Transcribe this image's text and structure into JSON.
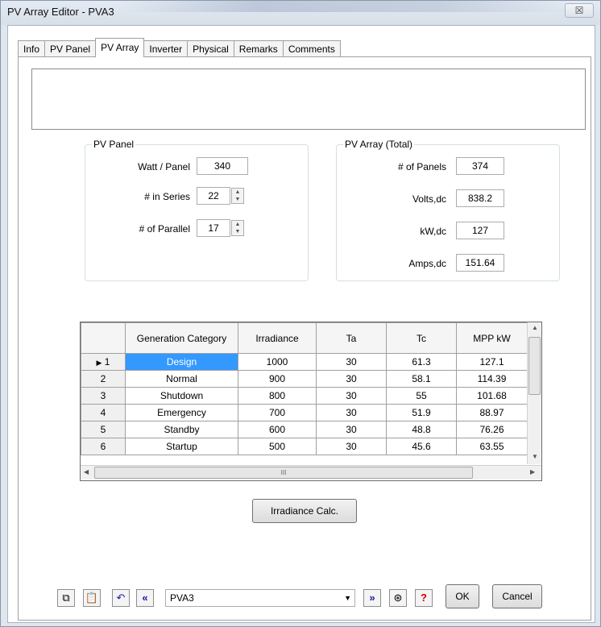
{
  "window": {
    "title": "PV Array Editor - PVA3",
    "close_glyph": "☒"
  },
  "tabs": [
    {
      "label": "Info"
    },
    {
      "label": "PV Panel"
    },
    {
      "label": "PV Array"
    },
    {
      "label": "Inverter"
    },
    {
      "label": "Physical"
    },
    {
      "label": "Remarks"
    },
    {
      "label": "Comments"
    }
  ],
  "pv_panel": {
    "title": "PV Panel",
    "watt_label": "Watt / Panel",
    "watt_value": "340",
    "series_label": "# in Series",
    "series_value": "22",
    "parallel_label": "# of Parallel",
    "parallel_value": "17"
  },
  "pv_array": {
    "title": "PV Array (Total)",
    "panels_label": "# of Panels",
    "panels_value": "374",
    "volts_label": "Volts,dc",
    "volts_value": "838.2",
    "kw_label": "kW,dc",
    "kw_value": "127",
    "amps_label": "Amps,dc",
    "amps_value": "151.64"
  },
  "grid": {
    "columns": [
      "",
      "Generation Category",
      "Irradiance",
      "Ta",
      "Tc",
      "MPP kW"
    ],
    "rows": [
      {
        "num": "1",
        "category": "Design",
        "irradiance": "1000",
        "ta": "30",
        "tc": "61.3",
        "mpp": "127.1"
      },
      {
        "num": "2",
        "category": "Normal",
        "irradiance": "900",
        "ta": "30",
        "tc": "58.1",
        "mpp": "114.39"
      },
      {
        "num": "3",
        "category": "Shutdown",
        "irradiance": "800",
        "ta": "30",
        "tc": "55",
        "mpp": "101.68"
      },
      {
        "num": "4",
        "category": "Emergency",
        "irradiance": "700",
        "ta": "30",
        "tc": "51.9",
        "mpp": "88.97"
      },
      {
        "num": "5",
        "category": "Standby",
        "irradiance": "600",
        "ta": "30",
        "tc": "48.8",
        "mpp": "76.26"
      },
      {
        "num": "6",
        "category": "Startup",
        "irradiance": "500",
        "ta": "30",
        "tc": "45.6",
        "mpp": "63.55"
      }
    ],
    "selected_row_marker": "▶",
    "hscroll_grip": "III"
  },
  "buttons": {
    "irradiance_calc": "Irradiance Calc.",
    "ok": "OK",
    "cancel": "Cancel"
  },
  "bottom": {
    "selector_value": "PVA3",
    "icons": [
      "copy-icon",
      "paste-icon",
      "undo-icon",
      "previous-icon",
      "next-icon",
      "find-icon",
      "help-icon"
    ]
  },
  "colors": {
    "selection": "#3399ff",
    "help": "#d40000",
    "nav_arrow": "#1a1aa8"
  }
}
